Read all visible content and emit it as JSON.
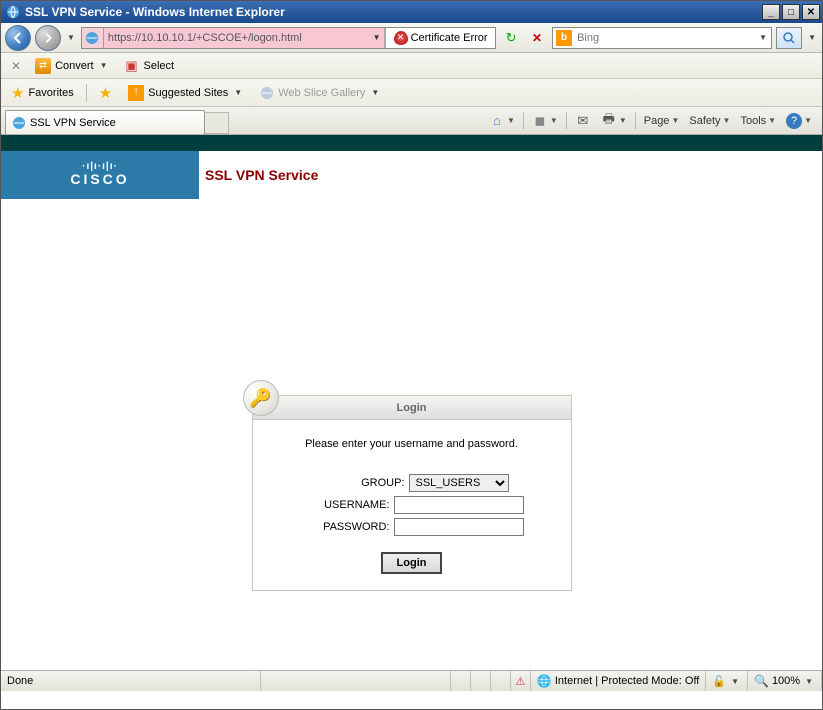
{
  "titlebar": {
    "text": "SSL VPN Service - Windows Internet Explorer"
  },
  "address": {
    "url": "https://10.10.10.1/+CSCOE+/logon.html",
    "cert_error": "Certificate Error"
  },
  "search": {
    "engine": "Bing",
    "value": ""
  },
  "convertbar": {
    "convert": "Convert",
    "select": "Select"
  },
  "favbar": {
    "favorites": "Favorites",
    "suggested": "Suggested Sites",
    "webslice": "Web Slice Gallery"
  },
  "tab": {
    "title": "SSL VPN Service"
  },
  "cmd": {
    "page": "Page",
    "safety": "Safety",
    "tools": "Tools"
  },
  "page": {
    "service_title": "SSL VPN Service",
    "cisco": "CISCO",
    "login_head": "Login",
    "login_msg": "Please enter your username and password.",
    "group_label": "GROUP:",
    "group_value": "SSL_USERS",
    "username_label": "USERNAME:",
    "password_label": "PASSWORD:",
    "login_btn": "Login"
  },
  "status": {
    "done": "Done",
    "zone": "Internet | Protected Mode: Off",
    "zoom": "100%"
  }
}
